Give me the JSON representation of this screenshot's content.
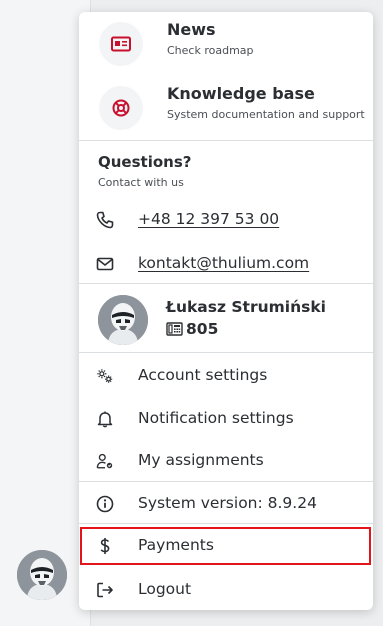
{
  "colors": {
    "accent_red": "#e3151b",
    "icon_red": "#c8102e",
    "text": "#2b2f33"
  },
  "features": [
    {
      "title": "News",
      "subtitle": "Check roadmap",
      "icon": "news-card-icon"
    },
    {
      "title": "Knowledge base",
      "subtitle": "System documentation and support",
      "icon": "lifebuoy-icon"
    }
  ],
  "contact": {
    "title": "Questions?",
    "subtitle": "Contact with us",
    "phone": "+48 12 397 53 00",
    "email": "kontakt@thulium.com"
  },
  "user": {
    "name": "Łukasz Strumiński",
    "extension": "805"
  },
  "settings": {
    "account": "Account settings",
    "notifications": "Notification settings",
    "assignments": "My assignments"
  },
  "system": {
    "version_label": "System version: 8.9.24"
  },
  "actions": {
    "payments": "Payments",
    "logout": "Logout"
  }
}
